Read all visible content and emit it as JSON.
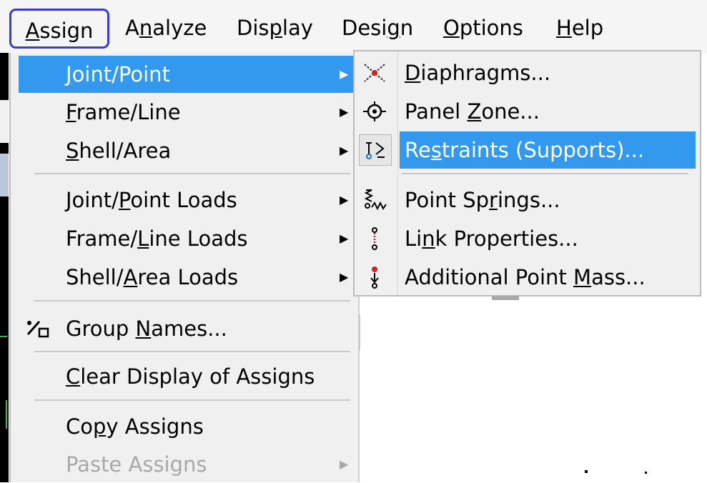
{
  "menubar": {
    "items": [
      {
        "pre": "",
        "ul": "A",
        "post": "ssign"
      },
      {
        "pre": "A",
        "ul": "n",
        "post": "alyze"
      },
      {
        "pre": "Dis",
        "ul": "p",
        "post": "lay"
      },
      {
        "pre": "Desi",
        "ul": "g",
        "post": "n"
      },
      {
        "pre": "",
        "ul": "O",
        "post": "ptions"
      },
      {
        "pre": "",
        "ul": "H",
        "post": "elp"
      }
    ]
  },
  "assign_menu": {
    "items": [
      {
        "pre": "",
        "ul": "J",
        "post": "oint/Point",
        "submenu": true
      },
      {
        "pre": "",
        "ul": "F",
        "post": "rame/Line",
        "submenu": true
      },
      {
        "pre": "",
        "ul": "S",
        "post": "hell/Area",
        "submenu": true
      },
      {
        "pre": "Joint/",
        "ul": "P",
        "post": "oint Loads",
        "submenu": true
      },
      {
        "pre": "Frame/",
        "ul": "L",
        "post": "ine Loads",
        "submenu": true
      },
      {
        "pre": "Shell/",
        "ul": "A",
        "post": "rea Loads",
        "submenu": true
      },
      {
        "pre": "Group ",
        "ul": "N",
        "post": "ames...",
        "submenu": false
      },
      {
        "pre": "",
        "ul": "C",
        "post": "lear Display of Assigns",
        "submenu": false
      },
      {
        "pre": "Co",
        "ul": "p",
        "post": "y Assigns",
        "submenu": false
      },
      {
        "pre": "Paste Assigns",
        "ul": "",
        "post": "",
        "submenu": true
      }
    ]
  },
  "joint_point_submenu": {
    "items": [
      {
        "pre": "",
        "ul": "D",
        "post": "iaphragms...",
        "icon": "diaphragm-icon"
      },
      {
        "pre": "Panel ",
        "ul": "Z",
        "post": "one...",
        "icon": "panel-zone-icon"
      },
      {
        "pre": "Re",
        "ul": "s",
        "post": "traints (Supports)...",
        "icon": "restraints-icon"
      },
      {
        "pre": "Point Sp",
        "ul": "r",
        "post": "ings...",
        "icon": "point-springs-icon"
      },
      {
        "pre": "Li",
        "ul": "n",
        "post": "k Properties...",
        "icon": "link-properties-icon"
      },
      {
        "pre": "Additional Point ",
        "ul": "M",
        "post": "ass...",
        "icon": "point-mass-icon"
      }
    ]
  },
  "colors": {
    "highlight": "#3399ee",
    "menu_bg": "#f0f0f0",
    "assign_outline": "#3b3bd4",
    "disabled_text": "#a8a8a8"
  }
}
